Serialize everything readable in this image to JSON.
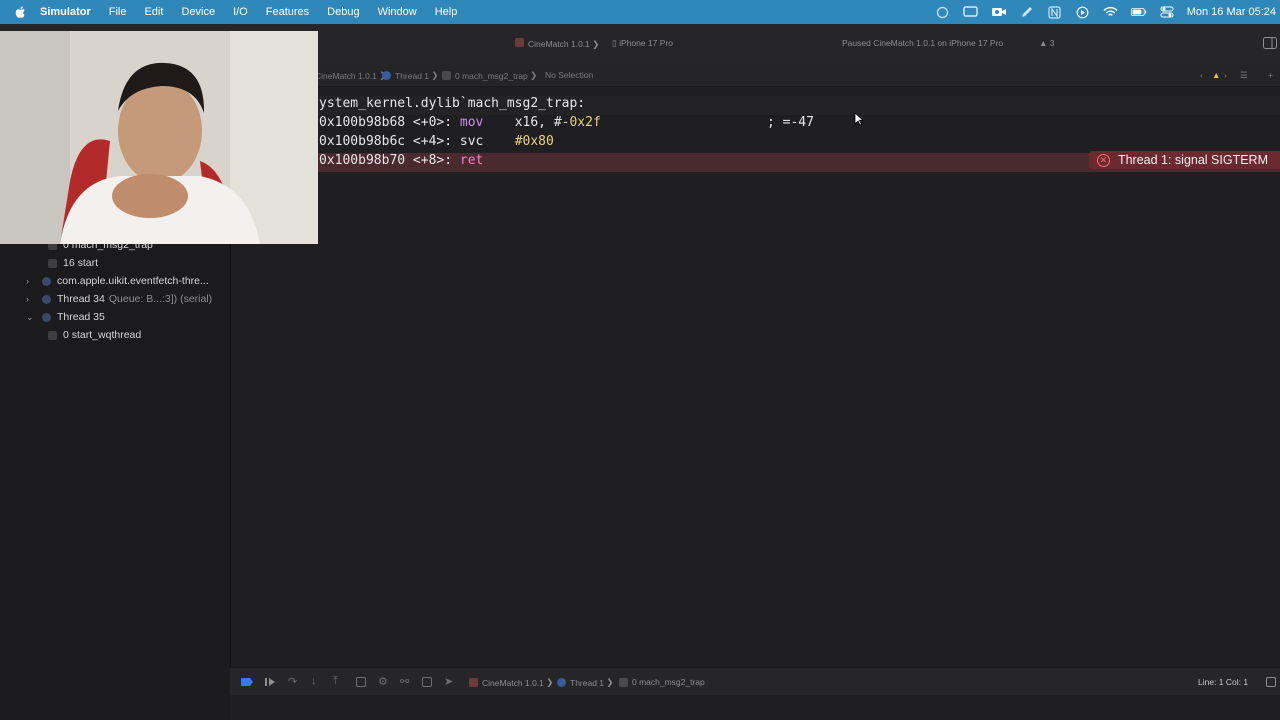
{
  "menubar": {
    "items": [
      "Simulator",
      "File",
      "Edit",
      "Device",
      "I/O",
      "Features",
      "Debug",
      "Window",
      "Help"
    ],
    "clock": "Mon 16 Mar  05:24"
  },
  "toolbar": {
    "scheme": "CineMatch 1.0.1",
    "device": "iPhone 17 Pro",
    "status": "Paused CineMatch 1.0.1 on iPhone 17 Pro",
    "warnings": "3"
  },
  "jumpbar": {
    "app": "CineMatch 1.0.1",
    "thread": "Thread 1",
    "frame": "0 mach_msg2_trap",
    "selection": "No Selection"
  },
  "sidebar": {
    "rows": [
      {
        "label": "0 mach_msg2_trap",
        "kind": "frame"
      },
      {
        "label": "16 start",
        "kind": "frame"
      },
      {
        "label": "com.apple.uikit.eventfetch-thre...",
        "kind": "thread",
        "expanded": false
      },
      {
        "label": "Thread 34",
        "detail": "Queue: B...:3]) (serial)",
        "kind": "thread",
        "expanded": false
      },
      {
        "label": "Thread 35",
        "kind": "thread",
        "expanded": true
      },
      {
        "label": "0 start_wqthread",
        "kind": "frame"
      }
    ]
  },
  "code": {
    "header": "ystem_kernel.dylib`mach_msg2_trap:",
    "lines": [
      {
        "addr": "0x100b98b68 <+0>: ",
        "op": "mov",
        "args_a": "x16, #",
        "args_b": "-0x2f",
        "comment": "; =-47"
      },
      {
        "addr": "0x100b98b6c <+4>: ",
        "op": "svc",
        "args_a": "",
        "args_b": "#0x80",
        "comment": ""
      },
      {
        "addr": "0x100b98b70 <+8>: ",
        "op": "ret",
        "args_a": "",
        "args_b": "",
        "comment": ""
      }
    ],
    "error": "Thread 1: signal SIGTERM"
  },
  "debugbar": {
    "app": "CineMatch 1.0.1",
    "thread": "Thread 1",
    "frame": "0 mach_msg2_trap",
    "position": "Line: 1  Col: 1"
  },
  "colors": {
    "menubar": "#2f88b9",
    "error_line": "#4a2a2e",
    "accent": "#3478f6"
  }
}
